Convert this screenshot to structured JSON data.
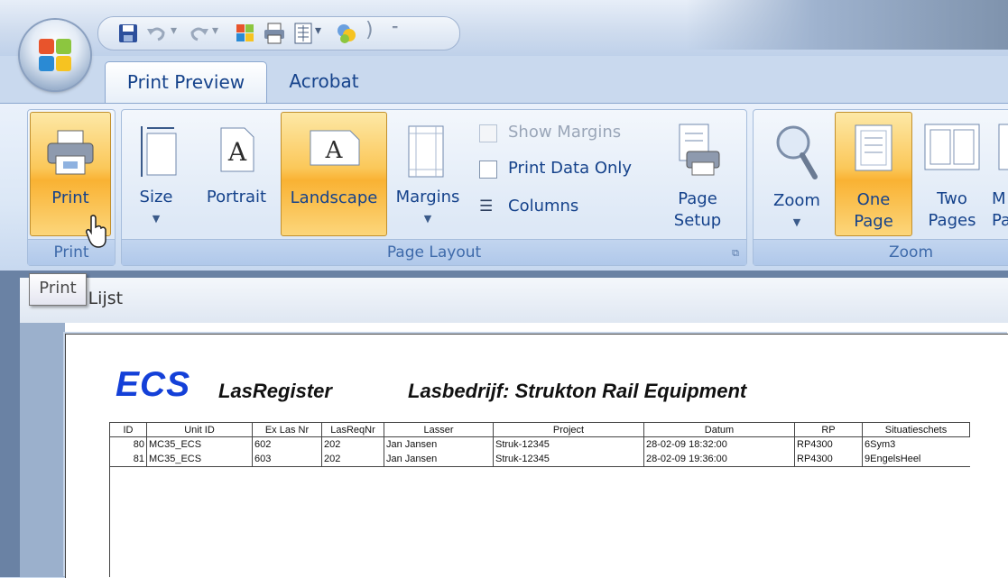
{
  "quick_access_toolbar": {
    "buttons": [
      "save-icon",
      "undo-icon",
      "redo-icon",
      "office-document-icon",
      "print-icon",
      "print-preview-icon",
      "dropdown-arrow-icon",
      "help-icon",
      "customize-icon"
    ]
  },
  "tabs": [
    {
      "label": "Print Preview",
      "active": true
    },
    {
      "label": "Acrobat",
      "active": false
    }
  ],
  "ribbon": {
    "print_group": {
      "label": "Print",
      "print_button": "Print"
    },
    "page_layout_group": {
      "label": "Page Layout",
      "size": "Size",
      "portrait": "Portrait",
      "landscape": "Landscape",
      "margins": "Margins",
      "show_margins": "Show Margins",
      "print_data_only": "Print Data Only",
      "columns": "Columns",
      "page_setup_line1": "Page",
      "page_setup_line2": "Setup"
    },
    "zoom_group": {
      "label": "Zoom",
      "zoom": "Zoom",
      "one_page_line1": "One",
      "one_page_line2": "Page",
      "two_pages_line1": "Two",
      "two_pages_line2": "Pages",
      "more_pages_line1": "M",
      "more_pages_line2": "Pa"
    }
  },
  "tooltip": "Print",
  "document_tab": {
    "label": "as Lijst"
  },
  "report": {
    "brand": "ECS",
    "title": "LasRegister",
    "company": "Lasbedrijf: Strukton Rail Equipment",
    "columns": [
      "ID",
      "Unit ID",
      "Ex Las Nr",
      "LasReqNr",
      "Lasser",
      "Project",
      "Datum",
      "RP",
      "Situatieschets"
    ],
    "rows": [
      [
        "80",
        "MC35_ECS",
        "602",
        "202",
        "Jan Jansen",
        "Struk-12345",
        "28-02-09 18:32:00",
        "RP4300",
        "6Sym3"
      ],
      [
        "81",
        "MC35_ECS",
        "603",
        "202",
        "Jan Jansen",
        "Struk-12345",
        "28-02-09 19:36:00",
        "RP4300",
        "9EngelsHeel"
      ]
    ]
  },
  "colors": {
    "ribbon_text": "#15428b",
    "active_button": "#fbc85a",
    "brand_blue": "#1440d8"
  }
}
